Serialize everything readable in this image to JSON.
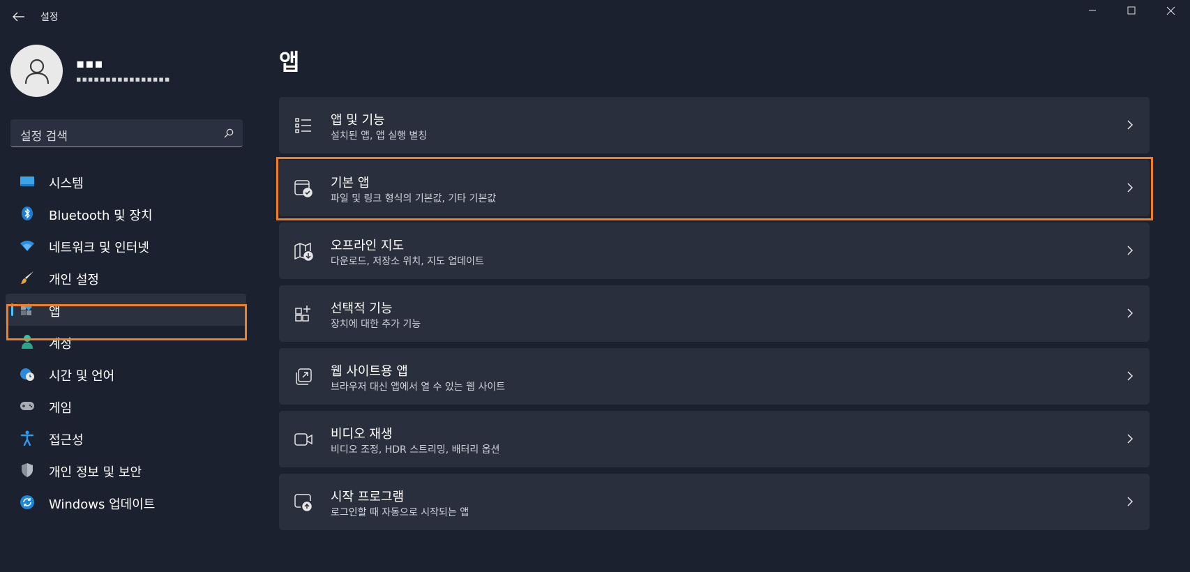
{
  "window": {
    "title": "설정",
    "buttons": [
      "minimize-icon",
      "maximize-icon",
      "close-icon"
    ]
  },
  "profile": {
    "name": "▪▪▪",
    "email": "▪▪▪▪▪▪▪▪▪▪▪▪▪▪▪▪"
  },
  "search": {
    "placeholder": "설정 검색",
    "icon": "search-icon"
  },
  "sidebar": {
    "items": [
      {
        "label": "시스템",
        "icon": "monitor-icon"
      },
      {
        "label": "Bluetooth 및 장치",
        "icon": "bluetooth-icon"
      },
      {
        "label": "네트워크 및 인터넷",
        "icon": "wifi-icon"
      },
      {
        "label": "개인 설정",
        "icon": "brush-icon"
      },
      {
        "label": "앱",
        "icon": "apps-icon",
        "selected": true
      },
      {
        "label": "계정",
        "icon": "person-icon"
      },
      {
        "label": "시간 및 언어",
        "icon": "globe-clock-icon"
      },
      {
        "label": "게임",
        "icon": "gamepad-icon"
      },
      {
        "label": "접근성",
        "icon": "accessibility-icon"
      },
      {
        "label": "개인 정보 및 보안",
        "icon": "shield-icon"
      },
      {
        "label": "Windows 업데이트",
        "icon": "update-icon"
      }
    ]
  },
  "main": {
    "title": "앱",
    "cards": [
      {
        "title": "앱 및 기능",
        "subtitle": "설치된 앱, 앱 실행 별칭",
        "icon": "list-icon"
      },
      {
        "title": "기본 앱",
        "subtitle": "파일 및 링크 형식의 기본값, 기타 기본값",
        "icon": "default-app-icon",
        "highlighted": true
      },
      {
        "title": "오프라인 지도",
        "subtitle": "다운로드, 저장소 위치, 지도 업데이트",
        "icon": "map-download-icon"
      },
      {
        "title": "선택적 기능",
        "subtitle": "장치에 대한 추가 기능",
        "icon": "grid-add-icon"
      },
      {
        "title": "웹 사이트용 앱",
        "subtitle": "브라우저 대신 앱에서 열 수 있는 웹 사이트",
        "icon": "open-external-icon"
      },
      {
        "title": "비디오 재생",
        "subtitle": "비디오 조정, HDR 스트리밍, 배터리 옵션",
        "icon": "video-icon"
      },
      {
        "title": "시작 프로그램",
        "subtitle": "로그인할 때 자동으로 시작되는 앱",
        "icon": "startup-icon"
      }
    ]
  },
  "colors": {
    "background": "#1c2130",
    "card": "#2a2f3d",
    "accent": "#4cc2ff",
    "highlight": "#f47f22"
  }
}
